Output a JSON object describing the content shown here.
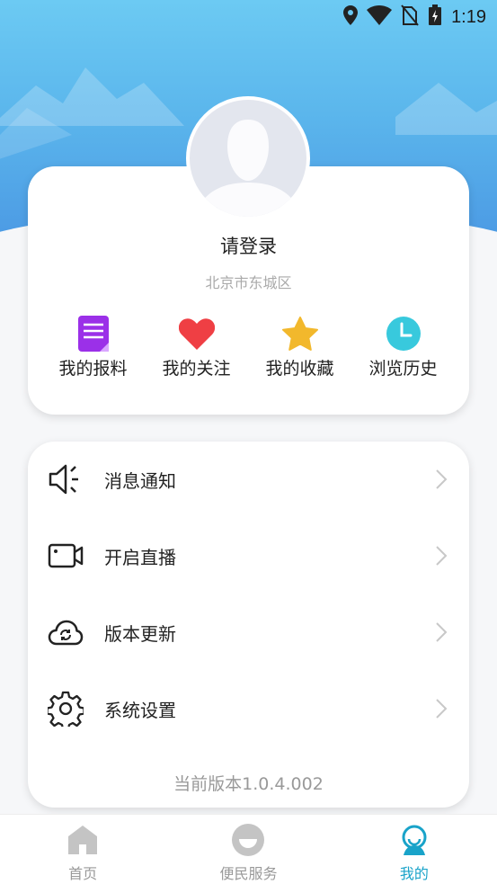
{
  "status_bar": {
    "time": "1:19",
    "icons": [
      "location-icon",
      "wifi-icon",
      "no-sim-icon",
      "battery-charging-icon"
    ]
  },
  "profile": {
    "login_prompt": "请登录",
    "location": "北京市东城区"
  },
  "quick_actions": [
    {
      "label": "我的报料",
      "icon": "report-document-icon",
      "color": "#9b30e8"
    },
    {
      "label": "我的关注",
      "icon": "heart-icon",
      "color": "#ef3f44"
    },
    {
      "label": "我的收藏",
      "icon": "star-icon",
      "color": "#f2b82c"
    },
    {
      "label": "浏览历史",
      "icon": "clock-icon",
      "color": "#38c9dd"
    }
  ],
  "menu": [
    {
      "label": "消息通知",
      "icon": "speaker-icon"
    },
    {
      "label": "开启直播",
      "icon": "video-camera-icon"
    },
    {
      "label": "版本更新",
      "icon": "cloud-sync-icon"
    },
    {
      "label": "系统设置",
      "icon": "gear-icon"
    }
  ],
  "version_text": "当前版本1.0.4.002",
  "bottom_nav": [
    {
      "label": "首页",
      "icon": "home-icon",
      "active": false
    },
    {
      "label": "便民服务",
      "icon": "service-icon",
      "active": false
    },
    {
      "label": "我的",
      "icon": "profile-icon",
      "active": true
    }
  ],
  "colors": {
    "accent": "#19a3c9",
    "header_top": "#6ccaf3",
    "header_bottom": "#4a97e3"
  }
}
